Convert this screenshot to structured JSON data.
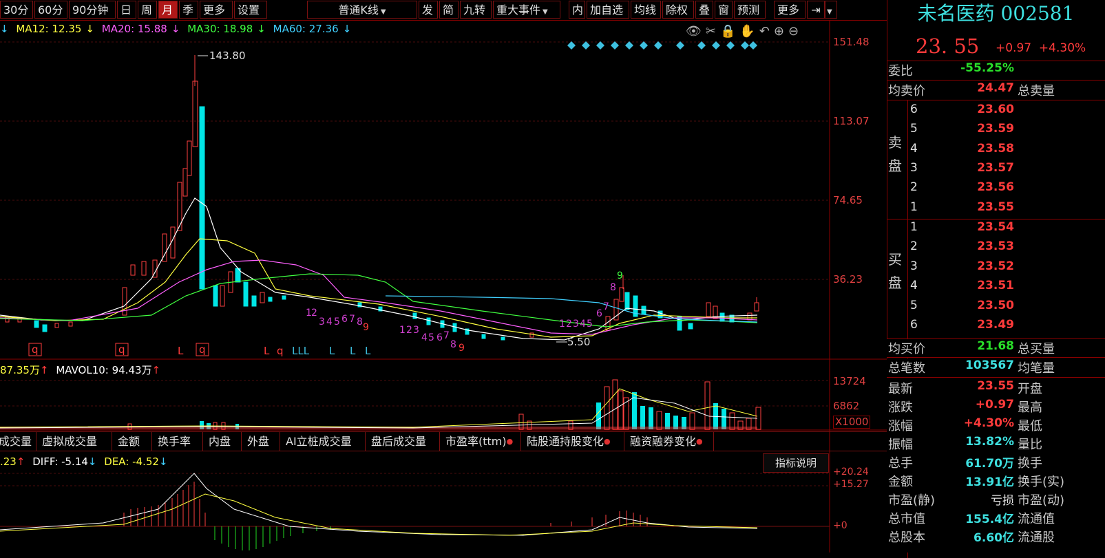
{
  "toolbar": {
    "items": [
      "30分",
      "60分",
      "90分钟",
      "日",
      "周",
      "月",
      "季",
      "更多",
      "设置"
    ],
    "active_index": 5,
    "chart_type": "普通K线",
    "right_items": [
      "发",
      "简",
      "九转",
      "重大事件",
      "内",
      "加自选",
      "均线",
      "除权",
      "叠",
      "窗",
      "预测",
      "更多"
    ]
  },
  "ma": {
    "ma12": "MA12: 12.35",
    "ma20": "MA20: 15.88",
    "ma30": "MA30: 18.98",
    "ma60": "MA60: 27.36",
    "colors": {
      "ma12": "#ffff40",
      "ma20": "#ff60ff",
      "ma30": "#40ff40",
      "ma60": "#40d0ff"
    }
  },
  "price_axis": [
    "151.48",
    "113.07",
    "74.65",
    "36.23"
  ],
  "annotations": {
    "high": "143.80",
    "low": "5.50"
  },
  "volume": {
    "legend_vol": "87.35万",
    "legend_mavol": "MAVOL10: 94.43万",
    "axis": [
      "13724",
      "6862"
    ],
    "unit": "X1000"
  },
  "tabs": [
    "成交量",
    "虚拟成交量",
    "金额",
    "换手率",
    "内盘",
    "外盘",
    "AI立桩成交量",
    "盘后成交量",
    "市盈率(ttm)",
    "陆股通持股变化",
    "融资融券变化"
  ],
  "macd": {
    "legend_first": ".23",
    "diff": "DIFF: -5.14",
    "dea": "DEA: -4.52",
    "axis": [
      "+20.24",
      "+15.27",
      "+0"
    ],
    "explain": "指标说明"
  },
  "stock": {
    "name": "未名医药",
    "code": "002581",
    "price": "23. 55",
    "change": "+0.97",
    "change_pct": "+4.30%"
  },
  "quote": {
    "weibi_label": "委比",
    "weibi": "-55.25%",
    "avg_sell_label": "均卖价",
    "avg_sell": "24.47",
    "total_sell_label": "总卖量",
    "sell_label_1": "卖",
    "sell_label_2": "盘",
    "buy_label_1": "买",
    "buy_label_2": "盘",
    "sell": [
      {
        "i": "6",
        "p": "23.60"
      },
      {
        "i": "5",
        "p": "23.59"
      },
      {
        "i": "4",
        "p": "23.58"
      },
      {
        "i": "3",
        "p": "23.57"
      },
      {
        "i": "2",
        "p": "23.56"
      },
      {
        "i": "1",
        "p": "23.55"
      }
    ],
    "buy": [
      {
        "i": "1",
        "p": "23.54"
      },
      {
        "i": "2",
        "p": "23.53"
      },
      {
        "i": "3",
        "p": "23.52"
      },
      {
        "i": "4",
        "p": "23.51"
      },
      {
        "i": "5",
        "p": "23.50"
      },
      {
        "i": "6",
        "p": "23.49"
      }
    ],
    "avg_buy_label": "均买价",
    "avg_buy": "21.68",
    "total_buy_label": "总买量",
    "trades_label": "总笔数",
    "trades": "103567",
    "avg_trade_label": "均笔量",
    "stats": [
      {
        "l": "最新",
        "v": "23.55",
        "r": "开盘",
        "c": "red"
      },
      {
        "l": "涨跌",
        "v": "+0.97",
        "r": "最高",
        "c": "red"
      },
      {
        "l": "涨幅",
        "v": "+4.30%",
        "r": "最低",
        "c": "red"
      },
      {
        "l": "振幅",
        "v": "13.82%",
        "r": "量比",
        "c": "cyan"
      },
      {
        "l": "总手",
        "v": "61.70万",
        "r": "换手",
        "c": "cyan"
      },
      {
        "l": "金额",
        "v": "13.91亿",
        "r": "换手(实)",
        "c": "cyan"
      },
      {
        "l": "市盈(静)",
        "v": "亏损",
        "r": "市盈(动)",
        "c": "white"
      },
      {
        "l": "总市值",
        "v": "155.4亿",
        "r": "流通值",
        "c": "cyan"
      },
      {
        "l": "总股本",
        "v": "6.60亿",
        "r": "流通股",
        "c": "cyan"
      }
    ]
  }
}
